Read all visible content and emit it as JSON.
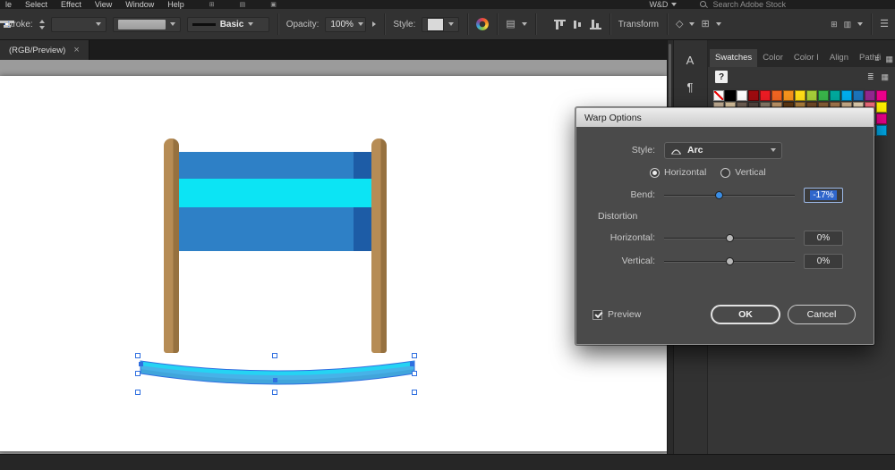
{
  "colors": {
    "accent": "#3a8ee6",
    "selection": "#2f6fe0",
    "post": "#b68c55",
    "post-shade": "#96713f",
    "banner-blue": "#2e80c6",
    "banner-dark": "#1d5ca6",
    "banner-cyan": "#0ce4f4",
    "arc-blue": "#47b2e8",
    "arc-cyan": "#25d3f3"
  },
  "menubar": {
    "items": [
      "le",
      "Select",
      "Effect",
      "View",
      "Window",
      "Help"
    ],
    "workspace": "W&D",
    "search_label": "Search Adobe Stock"
  },
  "controlbar": {
    "stroke_label": "Stroke:",
    "brush_label": "Basic",
    "opacity_label": "Opacity:",
    "opacity_value": "100%",
    "style_label": "Style:",
    "transform_label": "Transform"
  },
  "tabbar": {
    "document_title": "(RGB/Preview)",
    "close": "×"
  },
  "panels": {
    "tabs": [
      {
        "label": "Swatches",
        "active": true
      },
      {
        "label": "Color",
        "active": false
      },
      {
        "label": "Color I",
        "active": false
      },
      {
        "label": "Align",
        "active": false
      },
      {
        "label": "Pathfi",
        "active": false
      }
    ],
    "help_glyph": "?",
    "swatch_rows": [
      [
        "none",
        "#000000",
        "#ffffff",
        "#9e0b0f",
        "#ed1c24",
        "#f26522",
        "#f7941d",
        "#ffde17",
        "#a6ce39",
        "#39b54a",
        "#00a99d",
        "#00aeef",
        "#1c75bc",
        "#93278f",
        "#ec008c"
      ],
      [
        "#c7b299",
        "#dcc7a1",
        "#736357",
        "#534741",
        "#8b7d6b",
        "#c49a6c",
        "#603913",
        "#b3833f",
        "#754c29",
        "#8c6239",
        "#a97c50",
        "#d1b490",
        "#e7d4b5",
        "#f26d7d",
        "#fff200"
      ],
      [
        "#f58220",
        "#f7941d",
        "#fbaf5d",
        "#fdc689",
        "#7accc8",
        "#00bff3",
        "#448ccb",
        "#5674b9",
        "#8781bd",
        "#a186be",
        "#bd8cbf",
        "#f49ac1",
        "#f5989d",
        "#b8d8eb",
        "#ec008c"
      ],
      [
        "#440e62",
        "#630460",
        "#a3238e",
        "#d0189e",
        "#0d004c",
        "#1b1464",
        "#2e3192",
        "#0054a6",
        "#0076a3",
        "#0094d9",
        "#26a9e0",
        "#6dcff6",
        "#a2d9f7",
        "#bde2f0",
        "#00aeef"
      ]
    ]
  },
  "dialog": {
    "title": "Warp Options",
    "style_label": "Style:",
    "style_value": "Arc",
    "horizontal_option": "Horizontal",
    "vertical_option": "Vertical",
    "bend_label": "Bend:",
    "bend_value": "-17%",
    "distortion_label": "Distortion",
    "horizontal_label": "Horizontal:",
    "horizontal_value": "0%",
    "vertical_label": "Vertical:",
    "vertical_value": "0%",
    "preview_label": "Preview",
    "ok_label": "OK",
    "cancel_label": "Cancel"
  }
}
